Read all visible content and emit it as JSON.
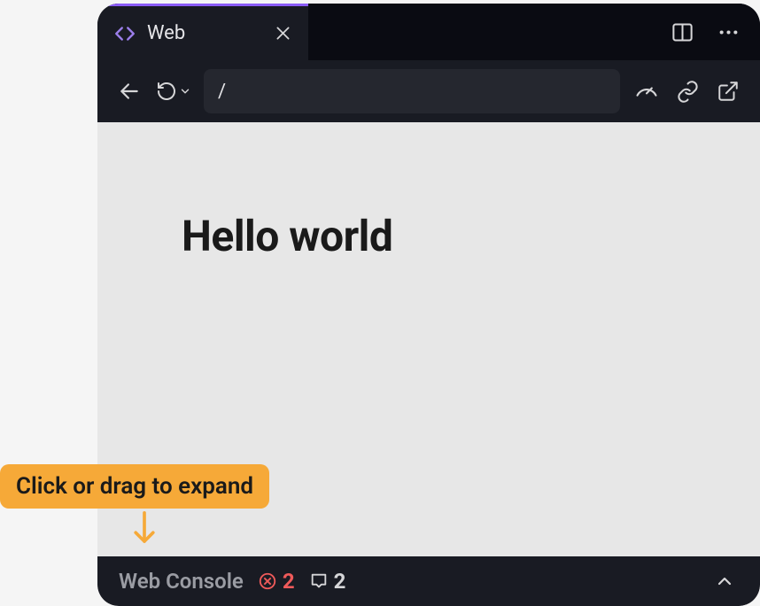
{
  "tab": {
    "title": "Web"
  },
  "address_bar": {
    "value": "/"
  },
  "page": {
    "heading": "Hello world"
  },
  "console": {
    "label": "Web Console",
    "error_count": "2",
    "message_count": "2"
  },
  "callout": {
    "text": "Click or drag to expand"
  }
}
